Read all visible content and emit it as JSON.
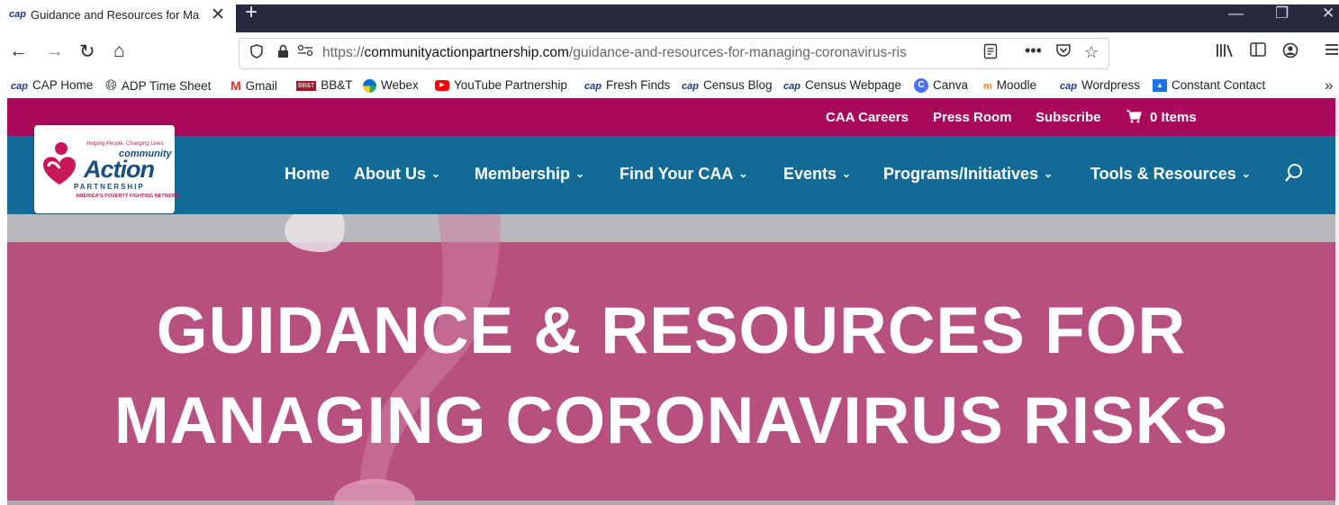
{
  "browser": {
    "tab": {
      "title": "Guidance and Resources for Ma",
      "favicon": "cap-favicon"
    },
    "new_tab_label": "+",
    "window_controls": {
      "minimize": "—",
      "restore": "❐",
      "close": "✕"
    },
    "nav": {
      "back": "←",
      "forward": "→",
      "reload": "↻",
      "home": "⌂"
    },
    "url": {
      "prefix": "https://",
      "domain": "communityactionpartnership.com",
      "path": "/guidance-and-resources-for-managing-coronavirus-ris"
    },
    "toolbar_icons": [
      "library-icon",
      "sidebar-icon",
      "account-icon",
      "menu-icon"
    ],
    "bookmarks": [
      {
        "label": "CAP Home",
        "icon": "cap-icon"
      },
      {
        "label": "ADP Time Sheet",
        "icon": "globe-icon"
      },
      {
        "label": "Gmail",
        "icon": "gmail-icon"
      },
      {
        "label": "BB&T",
        "icon": "bbt-icon"
      },
      {
        "label": "Webex",
        "icon": "webex-icon"
      },
      {
        "label": "YouTube Partnership",
        "icon": "youtube-icon"
      },
      {
        "label": "Fresh Finds",
        "icon": "cap-icon"
      },
      {
        "label": "Census Blog",
        "icon": "cap-icon"
      },
      {
        "label": "Census Webpage",
        "icon": "cap-icon"
      },
      {
        "label": "Canva",
        "icon": "canva-icon"
      },
      {
        "label": "Moodle",
        "icon": "moodle-icon"
      },
      {
        "label": "Wordpress",
        "icon": "cap-icon"
      },
      {
        "label": "Constant Contact",
        "icon": "constant-contact-icon"
      }
    ],
    "bookmarks_more": "»"
  },
  "site": {
    "topbar": {
      "links": [
        "CAA Careers",
        "Press Room",
        "Subscribe"
      ],
      "cart": "0 Items"
    },
    "logo": {
      "tagline": "Helping People. Changing Lives.",
      "community": "community",
      "action": "Action",
      "partnership": "PARTNERSHIP",
      "network": "AMERICA'S POVERTY FIGHTING NETWORK"
    },
    "menu": [
      {
        "label": "Home",
        "dropdown": false
      },
      {
        "label": "About Us",
        "dropdown": true
      },
      {
        "label": "Membership",
        "dropdown": true
      },
      {
        "label": "Find Your CAA",
        "dropdown": true
      },
      {
        "label": "Events",
        "dropdown": true
      },
      {
        "label": "Programs/Initiatives",
        "dropdown": true
      },
      {
        "label": "Tools & Resources",
        "dropdown": true
      }
    ],
    "hero": {
      "line1": "GUIDANCE & RESOURCES FOR",
      "line2": "MANAGING CORONAVIRUS RISKS"
    }
  },
  "colors": {
    "topbar": "#a8095a",
    "nav": "#126b96",
    "hero_band": "#b74f7f",
    "tabstrip_dark": "#272a3f"
  }
}
